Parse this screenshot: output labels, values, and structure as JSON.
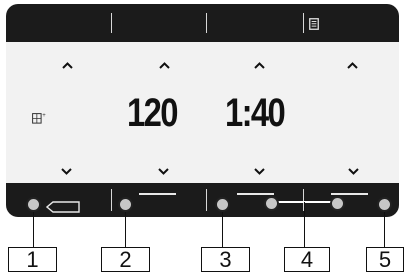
{
  "display": {
    "values": [
      "120",
      "1:40"
    ]
  },
  "icons": {
    "top_right": "document-icon",
    "screen_left": "setting-icon",
    "bottom_left": "back-arrow-icon",
    "up": "chevron-up-icon",
    "down": "chevron-down-icon"
  },
  "callouts": [
    "1",
    "2",
    "3",
    "4",
    "5"
  ],
  "colors": {
    "panel": "#1b1b1b",
    "screen": "#f2f2f2",
    "dot": "#c7c7c7",
    "text": "#111111"
  }
}
